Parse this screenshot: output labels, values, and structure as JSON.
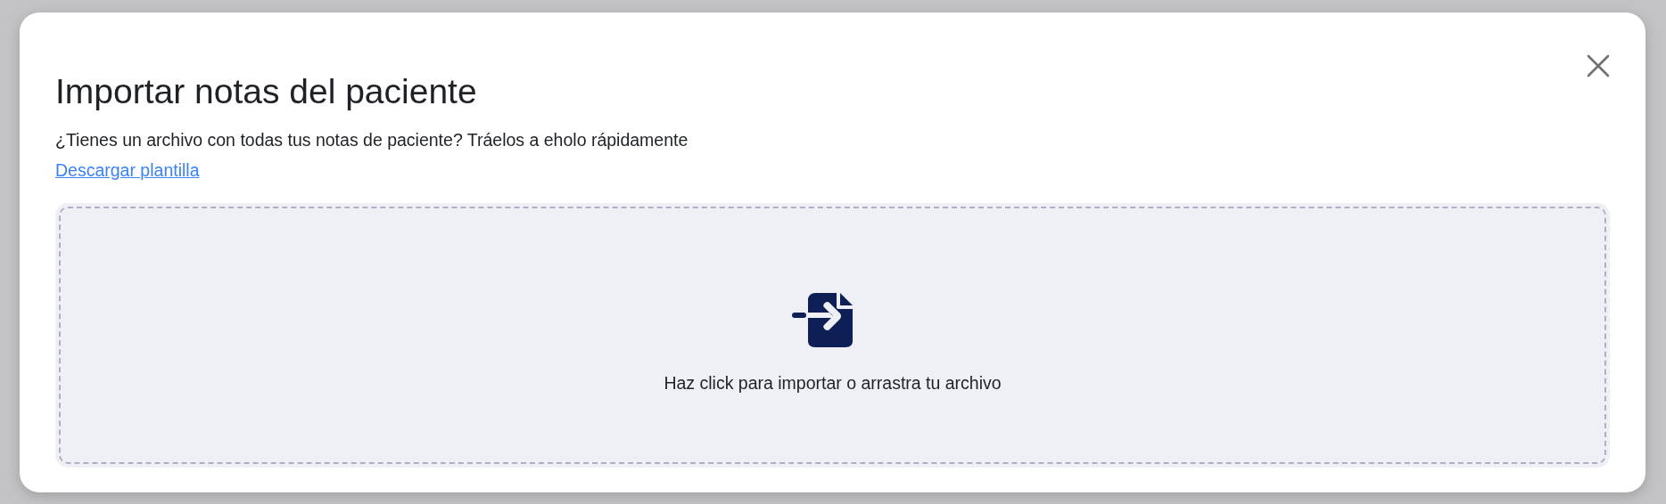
{
  "dialog": {
    "title": "Importar notas del paciente",
    "description": "¿Tienes un archivo con todas tus notas de paciente? Tráelos a eholo rápidamente",
    "template_link": "Descargar plantilla",
    "dropzone": {
      "label": "Haz click para importar o arrastra tu archivo"
    }
  }
}
